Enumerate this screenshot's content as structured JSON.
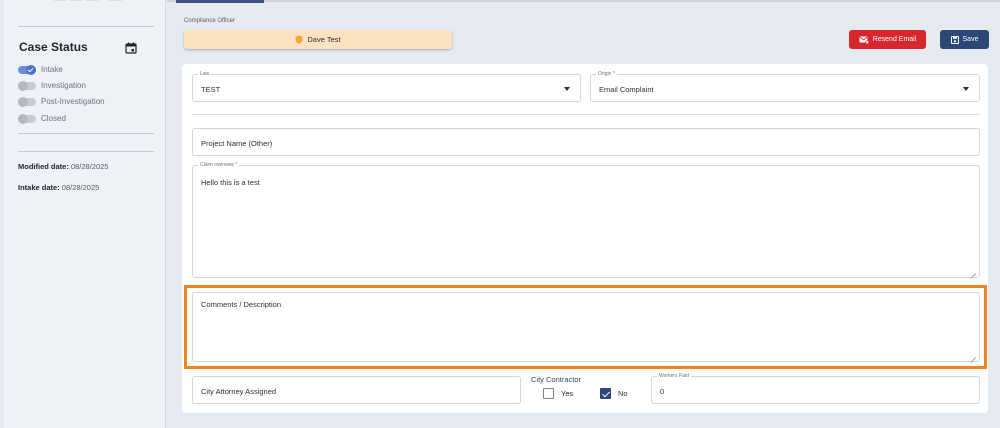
{
  "sidebar": {
    "case_status_title": "Case Status",
    "statuses": [
      {
        "label": "Intake",
        "active": true
      },
      {
        "label": "Investigation",
        "active": false
      },
      {
        "label": "Post-Investigation",
        "active": false
      },
      {
        "label": "Closed",
        "active": false
      }
    ],
    "modified_label": "Modified date:",
    "modified_value": "08/28/2025",
    "intake_label": "Intake date:",
    "intake_value": "08/28/2025"
  },
  "header": {
    "compliance_officer_label": "Compliance Officer",
    "officer_name": "Dave Test",
    "resend_email_label": "Resend Email",
    "save_label": "Save"
  },
  "form": {
    "law": {
      "label": "Law",
      "value": "TEST"
    },
    "origin": {
      "label": "Origin *",
      "value": "Email Complaint"
    },
    "project_name": {
      "placeholder": "Project Name (Other)"
    },
    "claim_overview": {
      "label": "Claim overview *",
      "value": "Hello this is a test"
    },
    "comments": {
      "placeholder": "Comments / Description"
    },
    "city_attorney": {
      "placeholder": "City Attorney Assigned"
    },
    "city_contractor": {
      "label": "City Contractor",
      "yes_label": "Yes",
      "yes_checked": false,
      "no_label": "No",
      "no_checked": true
    },
    "workers_paid": {
      "label": "Workers Paid",
      "value": "0"
    }
  },
  "colors": {
    "accent": "#2d4777",
    "danger": "#d8262d",
    "officer_bg": "#fbe2c1",
    "highlight": "#ef8424",
    "toggle_on": "#4b6fd0"
  },
  "icons": {
    "calendar": "calendar-icon",
    "shield": "shield-icon",
    "email": "email-icon",
    "save": "save-icon",
    "dropdown": "chevron-down-icon"
  }
}
